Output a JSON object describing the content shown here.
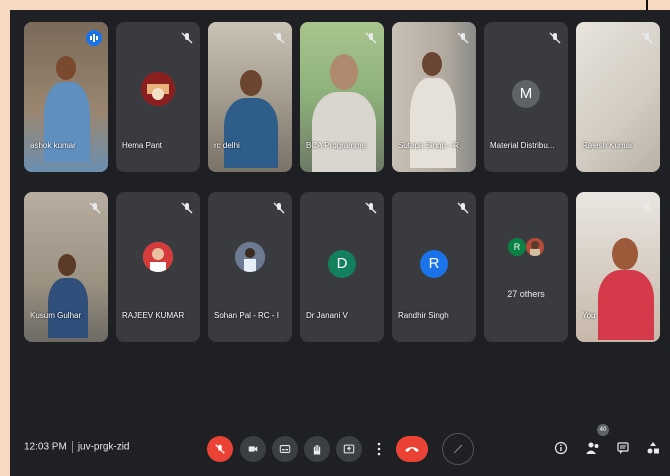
{
  "participants": [
    {
      "name": "ashok kumar",
      "kind": "video",
      "speaking": true
    },
    {
      "name": "Hema Pant",
      "kind": "image"
    },
    {
      "name": "rc delhi",
      "kind": "video"
    },
    {
      "name": "BCA Programme",
      "kind": "video"
    },
    {
      "name": "Sutapa Singh - R",
      "kind": "video"
    },
    {
      "name": "Material Distribu...",
      "kind": "letter",
      "initial": "M",
      "color": "#5f6368"
    },
    {
      "name": "Rajesh Kumar",
      "kind": "video"
    },
    {
      "name": "Kusum Gulhar",
      "kind": "video"
    },
    {
      "name": "RAJEEV KUMAR",
      "kind": "photo"
    },
    {
      "name": "Sohan Pal - RC - I",
      "kind": "photo"
    },
    {
      "name": "Dr Janani V",
      "kind": "letter",
      "initial": "D",
      "color": "#12805c"
    },
    {
      "name": "Randhir Singh",
      "kind": "letter",
      "initial": "R",
      "color": "#1a73e8"
    },
    {
      "name": "",
      "kind": "others",
      "others_label": "27 others",
      "initial": "R",
      "color": "#0b8043"
    },
    {
      "name": "You",
      "kind": "video"
    }
  ],
  "meeting": {
    "time": "12:03 PM",
    "code": "juv-prgk-zid",
    "people_count": "40"
  },
  "controls": {
    "mic": "mic-off-icon",
    "camera": "camera-off-icon",
    "captions": "captions-icon",
    "raise_hand": "raise-hand-icon",
    "present": "present-icon",
    "more": "more-options-icon",
    "leave": "leave-call-icon"
  },
  "colors": {
    "page_bg": "#f6d9bf",
    "meet_bg": "#1f2024",
    "tile_bg": "#3a3b3f",
    "active_outline": "#8ab4f8",
    "danger": "#ea4335"
  }
}
